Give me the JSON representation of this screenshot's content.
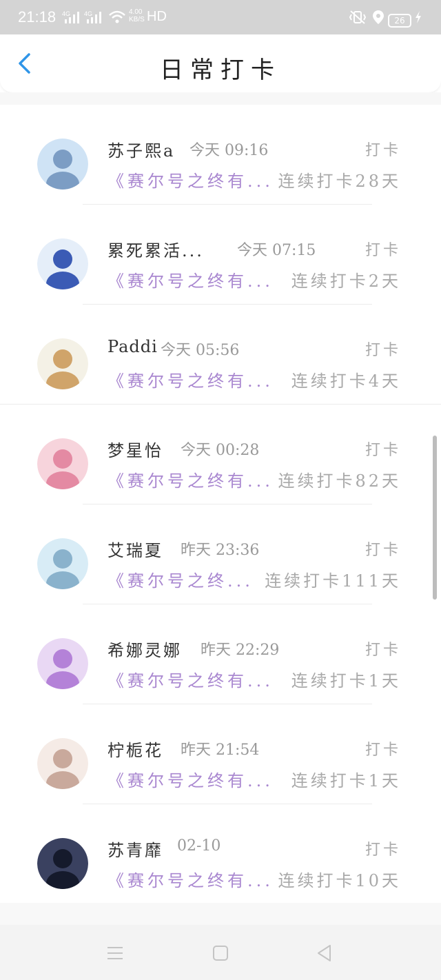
{
  "status_bar": {
    "time": "21:18",
    "signal_1": "4G",
    "signal_2": "4G",
    "net_speed_value": "4.00",
    "net_speed_unit": "KB/S",
    "hd": "HD",
    "battery": "26"
  },
  "header": {
    "title": "日常打卡"
  },
  "rows": [
    {
      "name": "苏子熙a",
      "time": "今天 09:16",
      "action": "打卡",
      "article": "《赛尔号之终有...",
      "streak": "连续打卡28天",
      "avatar_colors": [
        "#cfe3f5",
        "#7c9dc4"
      ]
    },
    {
      "name": "累死累活...",
      "time": "今天 07:15",
      "action": "打卡",
      "article": "《赛尔号之终有...",
      "streak": "连续打卡2天",
      "avatar_colors": [
        "#e5eef9",
        "#3b5bb5"
      ]
    },
    {
      "name": "Paddi",
      "time": "今天 05:56",
      "action": "打卡",
      "article": "《赛尔号之终有...",
      "streak": "连续打卡4天",
      "avatar_colors": [
        "#f4f1e6",
        "#d0a46a"
      ]
    },
    {
      "name": "梦星怡",
      "time": "今天 00:28",
      "action": "打卡",
      "article": "《赛尔号之终有...",
      "streak": "连续打卡82天",
      "avatar_colors": [
        "#f7d4dc",
        "#e48aa3"
      ]
    },
    {
      "name": "艾瑞夏",
      "time": "昨天 23:36",
      "action": "打卡",
      "article": "《赛尔号之终...",
      "streak": "连续打卡111天",
      "avatar_colors": [
        "#d8ecf6",
        "#8ab2cc"
      ]
    },
    {
      "name": "希娜灵娜",
      "time": "昨天 22:29",
      "action": "打卡",
      "article": "《赛尔号之终有...",
      "streak": "连续打卡1天",
      "avatar_colors": [
        "#e9d8f4",
        "#b482d8"
      ]
    },
    {
      "name": "柠栀花",
      "time": "昨天 21:54",
      "action": "打卡",
      "article": "《赛尔号之终有...",
      "streak": "连续打卡1天",
      "avatar_colors": [
        "#f5ebe6",
        "#c9a99c"
      ]
    },
    {
      "name": "苏青靡",
      "time": "02-10",
      "action": "打卡",
      "article": "《赛尔号之终有...",
      "streak": "连续打卡10天",
      "avatar_colors": [
        "#3a4160",
        "#151a2c"
      ]
    }
  ],
  "nav_bar": {
    "menu_icon": "menu-icon",
    "home_icon": "home-square-icon",
    "back_icon": "back-triangle-icon"
  }
}
